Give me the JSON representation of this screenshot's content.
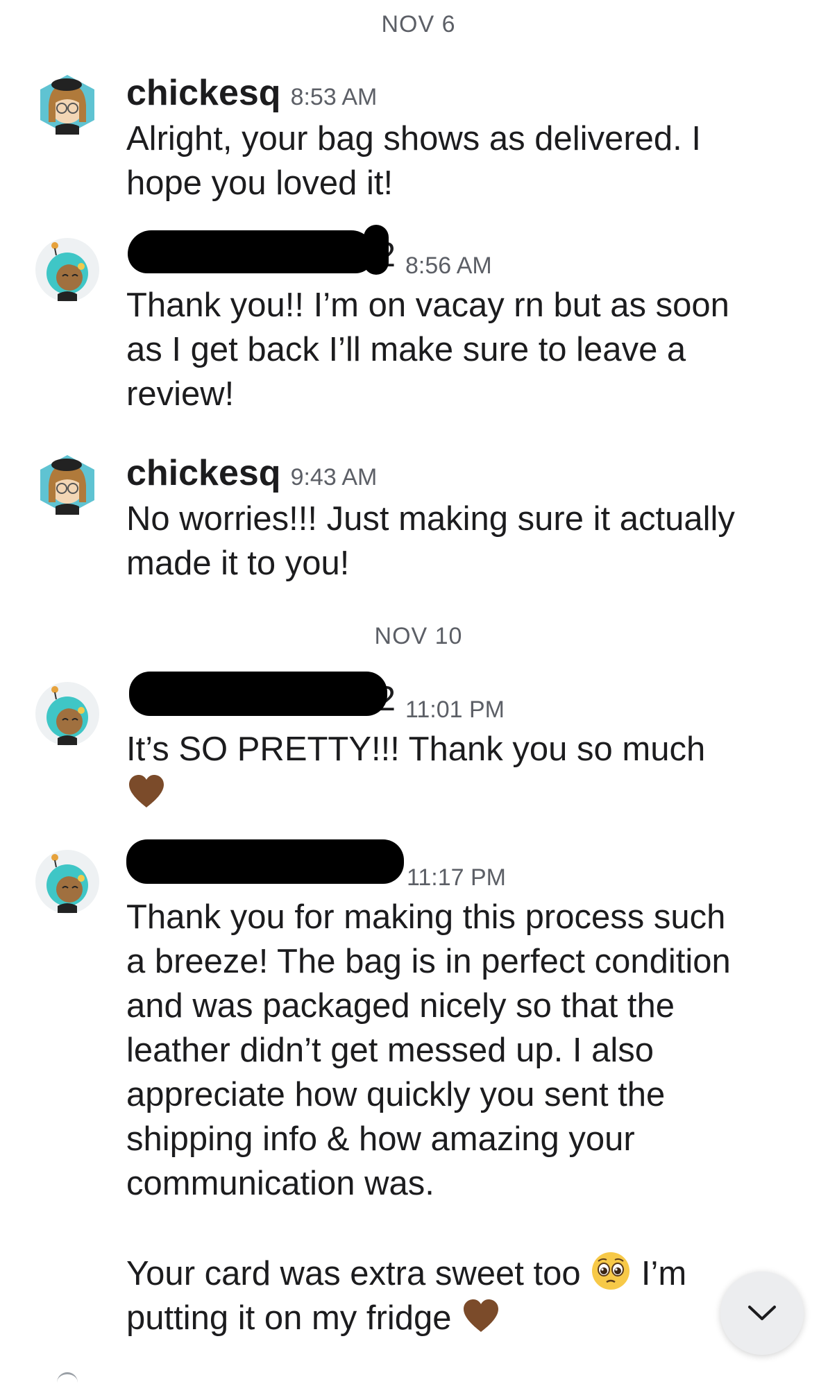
{
  "dates": {
    "first": "NOV 6",
    "second": "NOV 10"
  },
  "messages": [
    {
      "username": "chickesq",
      "time": "8:53 AM",
      "text": "Alright, your bag shows as delivered. I\nhope you loved it!"
    },
    {
      "username_visible_suffix": "2",
      "time": "8:56 AM",
      "text": "Thank you!! I’m on vacay rn but as soon\nas I get back I’ll make sure to leave a\nreview!"
    },
    {
      "username": "chickesq",
      "time": "9:43 AM",
      "text": "No worries!!! Just making sure it actually\nmade it to you!"
    },
    {
      "username_visible_suffix": "2",
      "time": "11:01 PM",
      "text": "It’s SO PRETTY!!! Thank you so much"
    },
    {
      "time": "11:17 PM",
      "text": "Thank you for making this process such\na breeze! The bag is in perfect condition\nand was packaged nicely so that the\nleather didn’t get messed up. I also\nappreciate how quickly you sent the\nshipping info & how amazing your\ncommunication was.",
      "text2_part1": "Your card was extra sweet too",
      "text2_part2": "I’m",
      "text2_line2": "putting it on my fridge"
    }
  ],
  "icons": {
    "heart": "brown-heart-icon",
    "pleading_face": "pleading-face-icon",
    "scroll_down": "chevron-down-icon"
  },
  "colors": {
    "text": "#1c1c1e",
    "muted": "#5c5f66",
    "heart": "#7b4b2a",
    "avatar_teal": "#5fd0cf",
    "redaction": "#000000"
  }
}
